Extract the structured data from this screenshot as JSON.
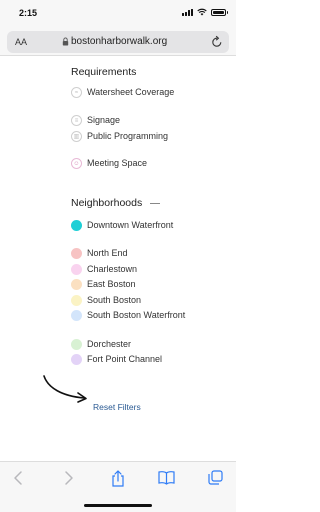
{
  "status": {
    "time": "2:15"
  },
  "browser": {
    "aa_label": "AA",
    "url": "bostonharborwalk.org"
  },
  "requirements": {
    "heading": "Requirements",
    "items": [
      {
        "label": "Watersheet Coverage",
        "icon": "watersheet-icon"
      },
      {
        "label": "Signage",
        "icon": "signage-icon"
      },
      {
        "label": "Public Programming",
        "icon": "public-programming-icon"
      },
      {
        "label": "Meeting Space",
        "icon": "meeting-space-icon"
      }
    ]
  },
  "neighborhoods": {
    "heading": "Neighborhoods",
    "items": [
      {
        "label": "Downtown Waterfront",
        "color": "#1ecfd6"
      },
      {
        "label": "North End",
        "color": "#f7c3c3"
      },
      {
        "label": "Charlestown",
        "color": "#f9d3ef"
      },
      {
        "label": "East Boston",
        "color": "#fbe0c1"
      },
      {
        "label": "South Boston",
        "color": "#fbf3c4"
      },
      {
        "label": "South Boston Waterfront",
        "color": "#d3e5fb"
      },
      {
        "label": "Dorchester",
        "color": "#d8f1d3"
      },
      {
        "label": "Fort Point Channel",
        "color": "#e3d3f7"
      }
    ]
  },
  "reset_label": "Reset Filters"
}
